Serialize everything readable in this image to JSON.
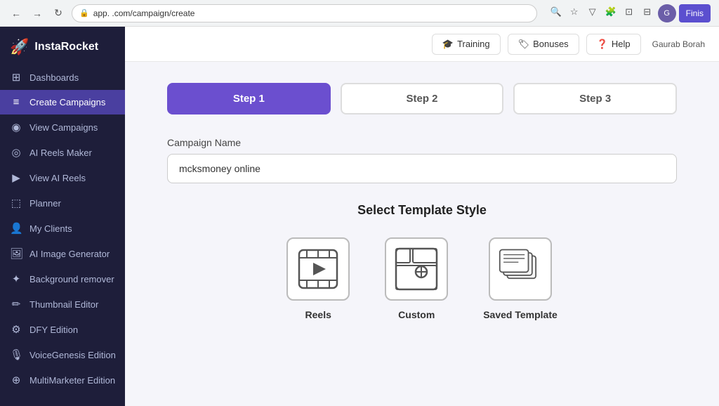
{
  "browser": {
    "url": "app.              .com/campaign/create",
    "finish_label": "Finis"
  },
  "logo": {
    "name": "InstaRocket"
  },
  "sidebar": {
    "items": [
      {
        "id": "dashboards",
        "label": "Dashboards",
        "icon": "⊞"
      },
      {
        "id": "create-campaigns",
        "label": "Create Campaigns",
        "icon": "≡"
      },
      {
        "id": "view-campaigns",
        "label": "View Campaigns",
        "icon": "👁"
      },
      {
        "id": "ai-reels-maker",
        "label": "AI Reels Maker",
        "icon": "◎"
      },
      {
        "id": "view-ai-reels",
        "label": "View AI Reels",
        "icon": "▶"
      },
      {
        "id": "planner",
        "label": "Planner",
        "icon": "📅"
      },
      {
        "id": "my-clients",
        "label": "My Clients",
        "icon": "👥"
      },
      {
        "id": "ai-image-generator",
        "label": "AI Image Generator",
        "icon": "🖼"
      },
      {
        "id": "background-remover",
        "label": "Background remover",
        "icon": "✂"
      },
      {
        "id": "thumbnail-editor",
        "label": "Thumbnail Editor",
        "icon": "🖊"
      },
      {
        "id": "dfy-edition",
        "label": "DFY Edition",
        "icon": "⚙"
      },
      {
        "id": "voicegenesis-edition",
        "label": "VoiceGenesis Edition",
        "icon": "🎙"
      },
      {
        "id": "multimarketer-edition",
        "label": "MultiMarketer Edition",
        "icon": "📡"
      }
    ]
  },
  "topnav": {
    "training_label": "Training",
    "bonuses_label": "Bonuses",
    "help_label": "Help",
    "user_name": "Gaurab Borah"
  },
  "steps": [
    {
      "label": "Step 1",
      "active": true
    },
    {
      "label": "Step 2",
      "active": false
    },
    {
      "label": "Step 3",
      "active": false
    }
  ],
  "form": {
    "campaign_name_label": "Campaign Name",
    "campaign_name_value": "mcksmoney online",
    "campaign_name_placeholder": "mcksmoney online"
  },
  "template_section": {
    "title": "Select Template Style",
    "templates": [
      {
        "id": "reels",
        "label": "Reels"
      },
      {
        "id": "custom",
        "label": "Custom"
      },
      {
        "id": "saved-template",
        "label": "Saved Template"
      }
    ]
  }
}
